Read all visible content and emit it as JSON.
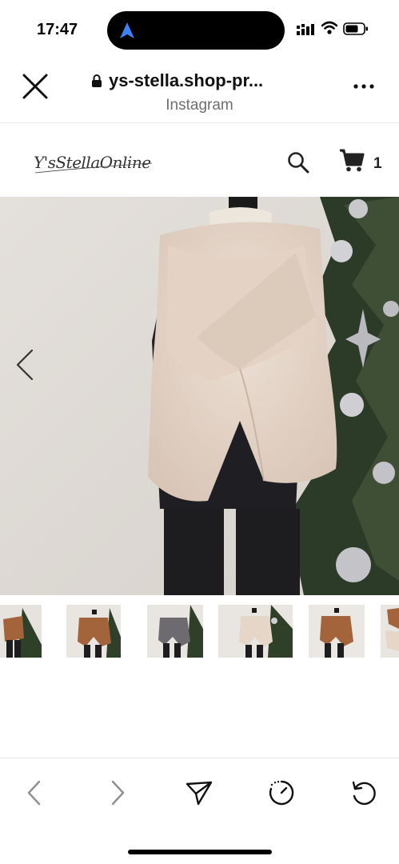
{
  "status_bar": {
    "time": "17:47",
    "icons": [
      "navigation-arrow-icon",
      "cellular-signal-icon",
      "wifi-icon",
      "battery-icon"
    ]
  },
  "browser": {
    "url": "ys-stella.shop-pr...",
    "source_label": "Instagram",
    "icons": [
      "close-icon",
      "lock-icon",
      "more-options-icon"
    ]
  },
  "site": {
    "logo_text": "Y'sStellaOnline",
    "cart_count": "1",
    "icons": [
      "search-icon",
      "cart-icon"
    ]
  },
  "gallery": {
    "main_image": "beige faux-fur cross stole on mannequin beside christmas tree",
    "thumbnails": [
      "brown fur stole",
      "brown fur stole",
      "gray fur stole",
      "beige fur stole",
      "brown fur stole",
      "beige fur stole"
    ]
  },
  "toolbar": {
    "icons": [
      "back-icon",
      "forward-icon",
      "share-icon",
      "history-icon",
      "reload-icon"
    ]
  },
  "colors": {
    "accent_blue": "#1f73e8",
    "fur_beige": "#e6d6c8",
    "fur_brown": "#a3643b",
    "fur_gray": "#6d6a70"
  }
}
